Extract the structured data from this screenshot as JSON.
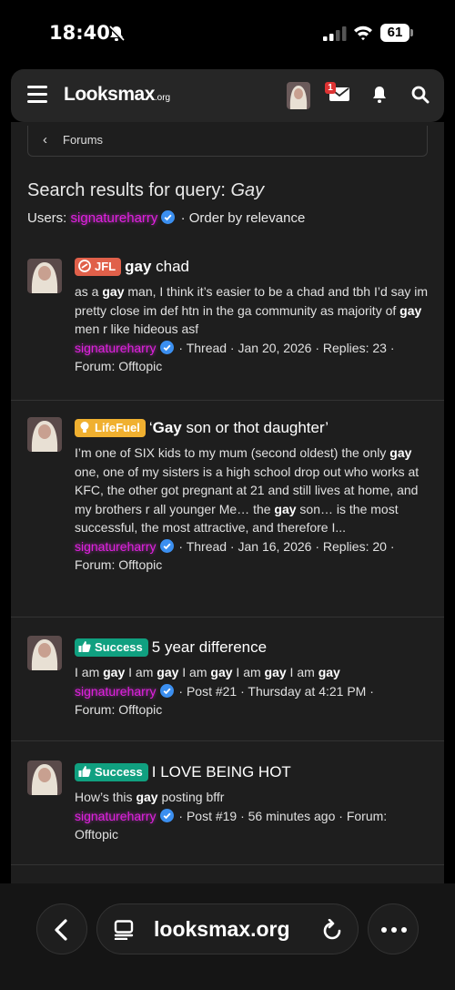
{
  "status_bar": {
    "time": "18:40",
    "battery": "61"
  },
  "header": {
    "logo_main": "Looksmax",
    "logo_suffix": ".org",
    "mail_badge": "1"
  },
  "breadcrumb": {
    "label": "Forums"
  },
  "search": {
    "title_prefix": "Search results for query: ",
    "query": "Gay",
    "users_label": "Users: ",
    "user": "signatureharry",
    "order_text": " · Order by relevance"
  },
  "results": [
    {
      "prefix": "JFL",
      "prefix_color": "#e0604a",
      "title_bold": "gay",
      "title_rest": " chad",
      "snippet_html": "as a <b>gay</b> man, I think it’s easier to be a chad and tbh I’d say im pretty close im def htn in the ga community as majority of <b>gay</b> men r like hideous asf",
      "user": "signatureharry",
      "meta_1": " · Thread · Jan 20, 2026 · Replies: 23 ·",
      "meta_2": "Forum: Offtopic"
    },
    {
      "prefix": "LifeFuel",
      "prefix_color": "#f0b030",
      "title_pre": "‘",
      "title_bold": "Gay",
      "title_rest": " son or thot daughter’",
      "snippet_html": "I’m one of SIX kids to my mum (second oldest) the only <b>gay</b> one, one of my sisters is a high school drop out who works at KFC, the other got pregnant at 21 and still lives at home, and my brothers r all younger Me… the <b>gay</b> son… is the most successful, the most attractive, and therefore I...",
      "user": "signatureharry",
      "meta_1": " · Thread · Jan 16, 2026 · Replies: 20 ·",
      "meta_2": "Forum: Offtopic"
    },
    {
      "prefix": "Success",
      "prefix_color": "#10a080",
      "title_rest": "5 year difference",
      "snippet_html": "I am <b>gay</b> I am <b>gay</b> I am <b>gay</b> I am <b>gay</b> I am <b>gay</b>",
      "user": "signatureharry",
      "meta_1": " · Post #21 · Thursday at 4:21 PM ·",
      "meta_2": "Forum: Offtopic"
    },
    {
      "prefix": "Success",
      "prefix_color": "#10a080",
      "title_rest": "I LOVE BEING HOT",
      "snippet_html": "How’s this <b>gay</b> posting bffr",
      "user": "signatureharry",
      "meta_1": " · Post #19 · 56 minutes ago · Forum:",
      "meta_2": "Offtopic"
    }
  ],
  "browser": {
    "url": "looksmax.org"
  }
}
